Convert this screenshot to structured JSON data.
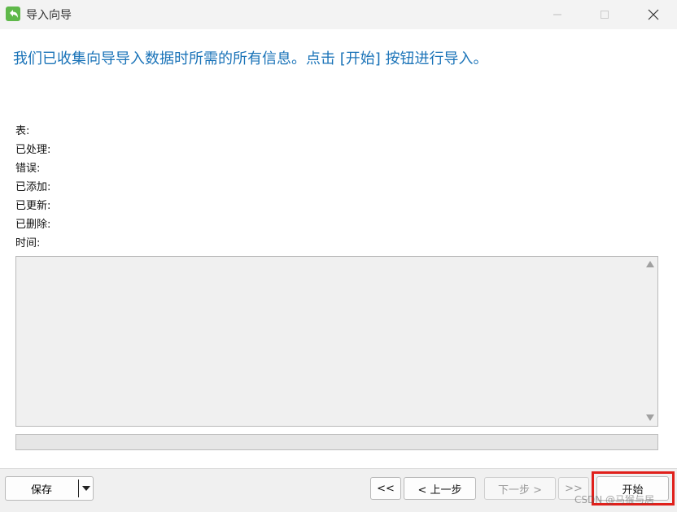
{
  "window": {
    "title": "导入向导",
    "controls": [
      "minimize-icon",
      "maximize-icon",
      "close-icon"
    ]
  },
  "headline": "我们已收集向导导入数据时所需的所有信息。点击 [开始] 按钮进行导入。",
  "stats": [
    {
      "label": "表:"
    },
    {
      "label": "已处理:"
    },
    {
      "label": "错误:"
    },
    {
      "label": "已添加:"
    },
    {
      "label": "已更新:"
    },
    {
      "label": "已删除:"
    },
    {
      "label": "时间:"
    }
  ],
  "progress": {
    "percent": 0
  },
  "footer": {
    "save_label": "保存",
    "first_label": "<<",
    "prev_label": "< 上一步",
    "next_label": "下一步 >",
    "last_label": ">>",
    "start_label": "开始"
  },
  "watermark": "CSDN @马猴与居",
  "colors": {
    "headline": "#1a73b8",
    "highlight": "#e0201b"
  }
}
